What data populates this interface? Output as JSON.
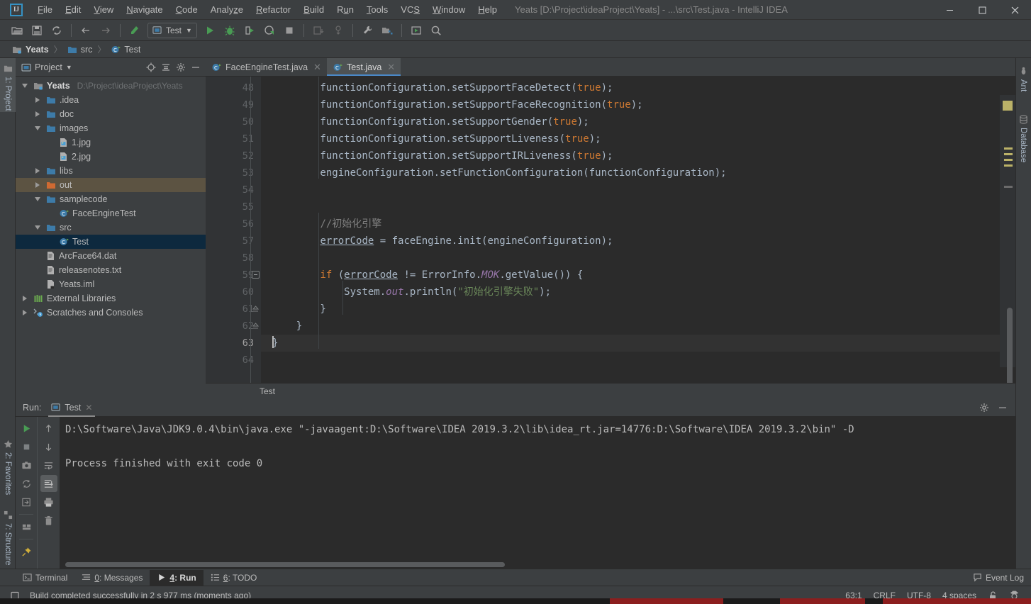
{
  "window": {
    "app_icon": "IJ",
    "title": "Yeats [D:\\Project\\ideaProject\\Yeats] - ...\\src\\Test.java - IntelliJ IDEA",
    "minimize": "—",
    "maximize": "❐",
    "close": "✕"
  },
  "menubar": [
    {
      "label": "File",
      "mnemonic": "F"
    },
    {
      "label": "Edit",
      "mnemonic": "E"
    },
    {
      "label": "View",
      "mnemonic": "V"
    },
    {
      "label": "Navigate",
      "mnemonic": "N"
    },
    {
      "label": "Code",
      "mnemonic": "C"
    },
    {
      "label": "Analyze",
      "mnemonic": "z"
    },
    {
      "label": "Refactor",
      "mnemonic": "R"
    },
    {
      "label": "Build",
      "mnemonic": "B"
    },
    {
      "label": "Run",
      "mnemonic": "u"
    },
    {
      "label": "Tools",
      "mnemonic": "T"
    },
    {
      "label": "VCS",
      "mnemonic": "S"
    },
    {
      "label": "Window",
      "mnemonic": "W"
    },
    {
      "label": "Help",
      "mnemonic": "H"
    }
  ],
  "toolbar": {
    "open_label": "Open",
    "save_label": "Save All",
    "sync_label": "Synchronize",
    "back_label": "Back",
    "forward_label": "Forward",
    "build_label": "Build Project",
    "run_config_name": "Test",
    "run_label": "Run",
    "debug_label": "Debug",
    "run_coverage_label": "Run with Coverage",
    "profile_label": "Profile",
    "stop_label": "Stop",
    "update_project_label": "Update Project",
    "commit_label": "Commit",
    "settings_label": "Settings",
    "project_structure_label": "Project Structure",
    "select_opened_label": "Select Opened File",
    "search_label": "Search Everywhere"
  },
  "breadcrumb": [
    {
      "label": "Yeats",
      "icon": "module-icon",
      "bold": true
    },
    {
      "label": "src",
      "icon": "folder-icon",
      "bold": false
    },
    {
      "label": "Test",
      "icon": "java-class-icon",
      "bold": false
    }
  ],
  "left_strip": [
    {
      "label": "1: Project",
      "mnemonic": "1",
      "icon": "project-icon",
      "active": true
    },
    {
      "label": "2: Favorites",
      "mnemonic": "2",
      "icon": "star-icon",
      "active": false
    },
    {
      "label": "7: Structure",
      "mnemonic": "7",
      "icon": "structure-icon",
      "active": false
    }
  ],
  "right_strip": [
    {
      "label": "Ant",
      "icon": "ant-icon"
    },
    {
      "label": "Database",
      "icon": "database-icon"
    }
  ],
  "project_panel": {
    "title": "Project",
    "icon": "project-icon",
    "dropdown": "▾",
    "buttons": [
      {
        "name": "locate-icon",
        "label": "Select Opened File"
      },
      {
        "name": "collapse-all-icon",
        "label": "Collapse All"
      },
      {
        "name": "gear-icon",
        "label": "Settings"
      },
      {
        "name": "hide-icon",
        "label": "Hide"
      }
    ],
    "tree": [
      {
        "label": "Yeats",
        "path": "D:\\Project\\ideaProject\\Yeats",
        "indent": 0,
        "state": "expanded",
        "icon": "module-icon",
        "bold": true,
        "style": "normal"
      },
      {
        "label": ".idea",
        "path": "",
        "indent": 1,
        "state": "collapsed",
        "icon": "folder-icon",
        "bold": false,
        "style": "normal"
      },
      {
        "label": "doc",
        "path": "",
        "indent": 1,
        "state": "collapsed",
        "icon": "folder-icon",
        "bold": false,
        "style": "normal"
      },
      {
        "label": "images",
        "path": "",
        "indent": 1,
        "state": "expanded",
        "icon": "folder-icon",
        "bold": false,
        "style": "normal"
      },
      {
        "label": "1.jpg",
        "path": "",
        "indent": 2,
        "state": "leaf",
        "icon": "image-file-icon",
        "bold": false,
        "style": "normal"
      },
      {
        "label": "2.jpg",
        "path": "",
        "indent": 2,
        "state": "leaf",
        "icon": "image-file-icon",
        "bold": false,
        "style": "normal"
      },
      {
        "label": "libs",
        "path": "",
        "indent": 1,
        "state": "collapsed",
        "icon": "folder-icon",
        "bold": false,
        "style": "normal"
      },
      {
        "label": "out",
        "path": "",
        "indent": 1,
        "state": "collapsed",
        "icon": "folder-orange-icon",
        "bold": false,
        "style": "highlight"
      },
      {
        "label": "samplecode",
        "path": "",
        "indent": 1,
        "state": "expanded",
        "icon": "folder-icon",
        "bold": false,
        "style": "normal"
      },
      {
        "label": "FaceEngineTest",
        "path": "",
        "indent": 2,
        "state": "leaf",
        "icon": "java-class-icon",
        "bold": false,
        "style": "normal"
      },
      {
        "label": "src",
        "path": "",
        "indent": 1,
        "state": "expanded",
        "icon": "folder-icon",
        "bold": false,
        "style": "normal"
      },
      {
        "label": "Test",
        "path": "",
        "indent": 2,
        "state": "leaf",
        "icon": "java-class-icon",
        "bold": false,
        "style": "selected"
      },
      {
        "label": "ArcFace64.dat",
        "path": "",
        "indent": 1,
        "state": "leaf",
        "icon": "file-icon",
        "bold": false,
        "style": "normal"
      },
      {
        "label": "releasenotes.txt",
        "path": "",
        "indent": 1,
        "state": "leaf",
        "icon": "file-icon",
        "bold": false,
        "style": "normal"
      },
      {
        "label": "Yeats.iml",
        "path": "",
        "indent": 1,
        "state": "leaf",
        "icon": "iml-file-icon",
        "bold": false,
        "style": "normal"
      },
      {
        "label": "External Libraries",
        "path": "",
        "indent": 0,
        "state": "collapsed",
        "icon": "libraries-icon",
        "bold": false,
        "style": "normal"
      },
      {
        "label": "Scratches and Consoles",
        "path": "",
        "indent": 0,
        "state": "collapsed",
        "icon": "scratches-icon",
        "bold": false,
        "style": "normal"
      }
    ]
  },
  "editor": {
    "tabs": [
      {
        "label": "FaceEngineTest.java",
        "icon": "java-class-icon",
        "active": false,
        "close": "✕"
      },
      {
        "label": "Test.java",
        "icon": "java-class-icon",
        "active": true,
        "close": "✕"
      }
    ],
    "breadcrumb_bottom": "Test",
    "first_line_number": 48,
    "current_line_number": 63,
    "lines": [
      {
        "n": 48,
        "indent": 8,
        "segments": [
          {
            "t": "functionConfiguration.setSupportFaceDetect(",
            "c": "plain"
          },
          {
            "t": "true",
            "c": "kw"
          },
          {
            "t": ");",
            "c": "plain"
          }
        ]
      },
      {
        "n": 49,
        "indent": 8,
        "segments": [
          {
            "t": "functionConfiguration.setSupportFaceRecognition(",
            "c": "plain"
          },
          {
            "t": "true",
            "c": "kw"
          },
          {
            "t": ");",
            "c": "plain"
          }
        ]
      },
      {
        "n": 50,
        "indent": 8,
        "segments": [
          {
            "t": "functionConfiguration.setSupportGender(",
            "c": "plain"
          },
          {
            "t": "true",
            "c": "kw"
          },
          {
            "t": ");",
            "c": "plain"
          }
        ]
      },
      {
        "n": 51,
        "indent": 8,
        "segments": [
          {
            "t": "functionConfiguration.setSupportLiveness(",
            "c": "plain"
          },
          {
            "t": "true",
            "c": "kw"
          },
          {
            "t": ");",
            "c": "plain"
          }
        ]
      },
      {
        "n": 52,
        "indent": 8,
        "segments": [
          {
            "t": "functionConfiguration.setSupportIRLiveness(",
            "c": "plain"
          },
          {
            "t": "true",
            "c": "kw"
          },
          {
            "t": ");",
            "c": "plain"
          }
        ]
      },
      {
        "n": 53,
        "indent": 8,
        "segments": [
          {
            "t": "engineConfiguration.setFunctionConfiguration(functionConfiguration);",
            "c": "plain"
          }
        ]
      },
      {
        "n": 54,
        "indent": 0,
        "segments": []
      },
      {
        "n": 55,
        "indent": 0,
        "segments": []
      },
      {
        "n": 56,
        "indent": 8,
        "segments": [
          {
            "t": "//初始化引擎",
            "c": "cmt"
          }
        ]
      },
      {
        "n": 57,
        "indent": 8,
        "segments": [
          {
            "t": "errorCode",
            "c": "underline"
          },
          {
            "t": " = faceEngine.init(engineConfiguration);",
            "c": "plain"
          }
        ]
      },
      {
        "n": 58,
        "indent": 0,
        "segments": []
      },
      {
        "n": 59,
        "indent": 8,
        "segments": [
          {
            "t": "if",
            "c": "kw"
          },
          {
            "t": " (",
            "c": "plain"
          },
          {
            "t": "errorCode",
            "c": "underline"
          },
          {
            "t": " != ErrorInfo.",
            "c": "plain"
          },
          {
            "t": "MOK",
            "c": "static"
          },
          {
            "t": ".getValue()) {",
            "c": "plain"
          }
        ]
      },
      {
        "n": 60,
        "indent": 12,
        "segments": [
          {
            "t": "System.",
            "c": "plain"
          },
          {
            "t": "out",
            "c": "static"
          },
          {
            "t": ".println(",
            "c": "plain"
          },
          {
            "t": "\"初始化引擎失败\"",
            "c": "str"
          },
          {
            "t": ");",
            "c": "plain"
          }
        ]
      },
      {
        "n": 61,
        "indent": 8,
        "segments": [
          {
            "t": "}",
            "c": "plain"
          }
        ]
      },
      {
        "n": 62,
        "indent": 4,
        "segments": [
          {
            "t": "}",
            "c": "plain"
          }
        ]
      },
      {
        "n": 63,
        "indent": 0,
        "segments": [
          {
            "t": "}",
            "c": "plain"
          }
        ],
        "current": true
      },
      {
        "n": 64,
        "indent": 0,
        "segments": []
      }
    ]
  },
  "run_panel": {
    "label": "Run:",
    "tab_label": "Test",
    "tab_icon": "run-config-icon",
    "tab_close": "✕",
    "settings_label": "Settings",
    "hide_label": "Hide",
    "left_tools": [
      {
        "name": "rerun-icon",
        "label": "Rerun"
      },
      {
        "name": "stop-icon",
        "label": "Stop"
      },
      {
        "name": "screenshot-icon",
        "label": "Dump Threads"
      },
      {
        "name": "restore-layout-icon",
        "label": "Restore Layout"
      },
      {
        "name": "export-icon",
        "label": "Export"
      },
      {
        "name": "layout-icon",
        "label": "Layout Settings"
      },
      {
        "name": "pin-icon",
        "label": "Pin Tab"
      }
    ],
    "right_tools": [
      {
        "name": "up-arrow-icon",
        "label": "Previous Occurrence"
      },
      {
        "name": "down-arrow-icon",
        "label": "Next Occurrence"
      },
      {
        "name": "soft-wrap-icon",
        "label": "Use Soft Wraps"
      },
      {
        "name": "scroll-to-end-icon",
        "label": "Scroll to End"
      },
      {
        "name": "print-icon",
        "label": "Print"
      },
      {
        "name": "trash-icon",
        "label": "Clear All"
      }
    ],
    "console_lines": [
      "D:\\Software\\Java\\JDK9.0.4\\bin\\java.exe \"-javaagent:D:\\Software\\IDEA 2019.3.2\\lib\\idea_rt.jar=14776:D:\\Software\\IDEA 2019.3.2\\bin\" -D",
      "",
      "Process finished with exit code 0"
    ]
  },
  "bottom_tabs": [
    {
      "label": "Terminal",
      "mnemonic": "",
      "icon": "terminal-icon",
      "active": false
    },
    {
      "label": "0: Messages",
      "mnemonic": "0",
      "icon": "messages-icon",
      "active": false
    },
    {
      "label": "4: Run",
      "mnemonic": "4",
      "icon": "run-icon",
      "active": true
    },
    {
      "label": "6: TODO",
      "mnemonic": "6",
      "icon": "todo-icon",
      "active": false
    }
  ],
  "event_log": {
    "label": "Event Log",
    "icon": "event-log-icon"
  },
  "statusbar": {
    "build_icon": "build-status-icon",
    "message": "Build completed successfully in 2 s 977 ms (moments ago)",
    "caret_position": "63:1",
    "line_separator": "CRLF",
    "encoding": "UTF-8",
    "indent": "4 spaces",
    "lock_icon": "unlocked-icon",
    "inspection_icon": "inspection-hector-icon"
  },
  "colors": {
    "window_bg": "#3c3f41",
    "editor_bg": "#2b2b2b",
    "gutter_bg": "#313335",
    "selection_blue": "#0d293e",
    "accent_blue": "#4a88c7",
    "green": "#499c54",
    "orange": "#cc7832",
    "string_green": "#6a8759",
    "purple": "#9876aa",
    "text": "#bbbbbb",
    "folder_blue": "#3d7ba8",
    "folder_orange": "#cf6a32",
    "marker_yellow": "#bbb268"
  }
}
